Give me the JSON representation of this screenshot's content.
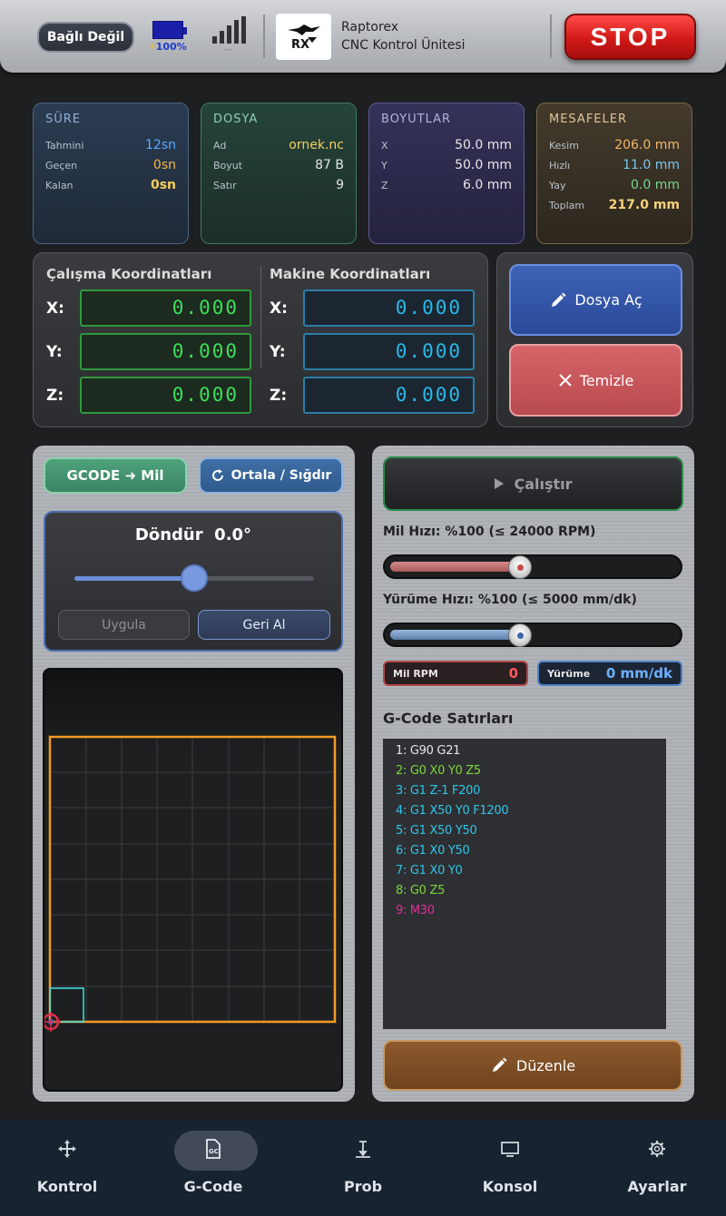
{
  "header": {
    "connection": "Bağlı Değil",
    "battery_icon": "battery-icon",
    "battery_bolt": "⚡",
    "battery_level": "100%",
    "signal_icon": "signal-bars-icon",
    "signal_text": "---",
    "logo_icon": "raptorex-logo",
    "brand_name": "Raptorex",
    "brand_subtitle": "CNC Kontrol Ünitesi",
    "stop_label": "STOP"
  },
  "cards": {
    "sure": {
      "title": "SÜRE",
      "rows": [
        {
          "label": "Tahmini",
          "value": "12sn"
        },
        {
          "label": "Geçen",
          "value": "0sn"
        },
        {
          "label": "Kalan",
          "value": "0sn"
        }
      ]
    },
    "dosya": {
      "title": "DOSYA",
      "rows": [
        {
          "label": "Ad",
          "value": "ornek.nc"
        },
        {
          "label": "Boyut",
          "value": "87 B"
        },
        {
          "label": "Satır",
          "value": "9"
        }
      ]
    },
    "boyutlar": {
      "title": "BOYUTLAR",
      "rows": [
        {
          "label": "X",
          "value": "50.0 mm"
        },
        {
          "label": "Y",
          "value": "50.0 mm"
        },
        {
          "label": "Z",
          "value": "6.0 mm"
        }
      ]
    },
    "mesafeler": {
      "title": "MESAFELER",
      "rows": [
        {
          "label": "Kesim",
          "value": "206.0 mm"
        },
        {
          "label": "Hızlı",
          "value": "11.0 mm"
        },
        {
          "label": "Yay",
          "value": "0.0 mm"
        },
        {
          "label": "Toplam",
          "value": "217.0 mm"
        }
      ]
    }
  },
  "coordinates": {
    "work_title": "Çalışma Koordinatları",
    "machine_title": "Makine Koordinatları",
    "axes": [
      "X:",
      "Y:",
      "Z:"
    ],
    "work": [
      "0.000",
      "0.000",
      "0.000"
    ],
    "machine": [
      "0.000",
      "0.000",
      "0.000"
    ]
  },
  "actions": {
    "open_label": "Dosya Aç",
    "clear_label": "Temizle"
  },
  "left_panel": {
    "gcode_mil_label": "GCODE ➜ Mil",
    "center_fit_label": "Ortala / Sığdır",
    "rotate_label": "Döndür",
    "rotate_value": "0.0°",
    "rotate_fraction": 0.5,
    "apply_label": "Uygula",
    "undo_label": "Geri Al"
  },
  "right_panel": {
    "run_label": "Çalıştır",
    "spindle_label": "Mil Hızı: %100  (≤ 24000 RPM)",
    "spindle_fraction": 0.45,
    "feed_label": "Yürüme Hızı: %100  (≤ 5000 mm/dk)",
    "feed_fraction": 0.45,
    "rpm_label": "Mil RPM",
    "rpm_value": "0",
    "feed_readout_label": "Yürüme",
    "feed_readout_value": "0 mm/dk",
    "gcode_title": "G-Code Satırları",
    "gcode_lines": [
      {
        "text": "1: G90 G21",
        "color": "#e6e6e6"
      },
      {
        "text": "2: G0 X0 Y0 Z5",
        "color": "#7cd83a"
      },
      {
        "text": "3: G1 Z-1 F200",
        "color": "#2fc6ea"
      },
      {
        "text": "4: G1 X50 Y0 F1200",
        "color": "#2fc6ea"
      },
      {
        "text": "5: G1 X50 Y50",
        "color": "#2fc6ea"
      },
      {
        "text": "6: G1 X0 Y50",
        "color": "#2fc6ea"
      },
      {
        "text": "7: G1 X0 Y0",
        "color": "#2fc6ea"
      },
      {
        "text": "8: G0 Z5",
        "color": "#7cd83a"
      },
      {
        "text": "9: M30",
        "color": "#e0309a"
      }
    ],
    "edit_label": "Düzenle"
  },
  "nav": {
    "active": 1,
    "items": [
      {
        "label": "Kontrol",
        "icon": "move-arrows-icon"
      },
      {
        "label": "G-Code",
        "icon": "gcode-file-icon"
      },
      {
        "label": "Prob",
        "icon": "probe-icon"
      },
      {
        "label": "Konsol",
        "icon": "console-icon"
      },
      {
        "label": "Ayarlar",
        "icon": "gear-icon"
      }
    ]
  },
  "colors": {
    "stop": "#d11a18",
    "work_dro": "#3be05a",
    "machine_dro": "#28b8ea",
    "toolpath_outline": "#f39c24",
    "toolpath_start": "#3be0e0",
    "origin_marker": "#e0304a"
  }
}
